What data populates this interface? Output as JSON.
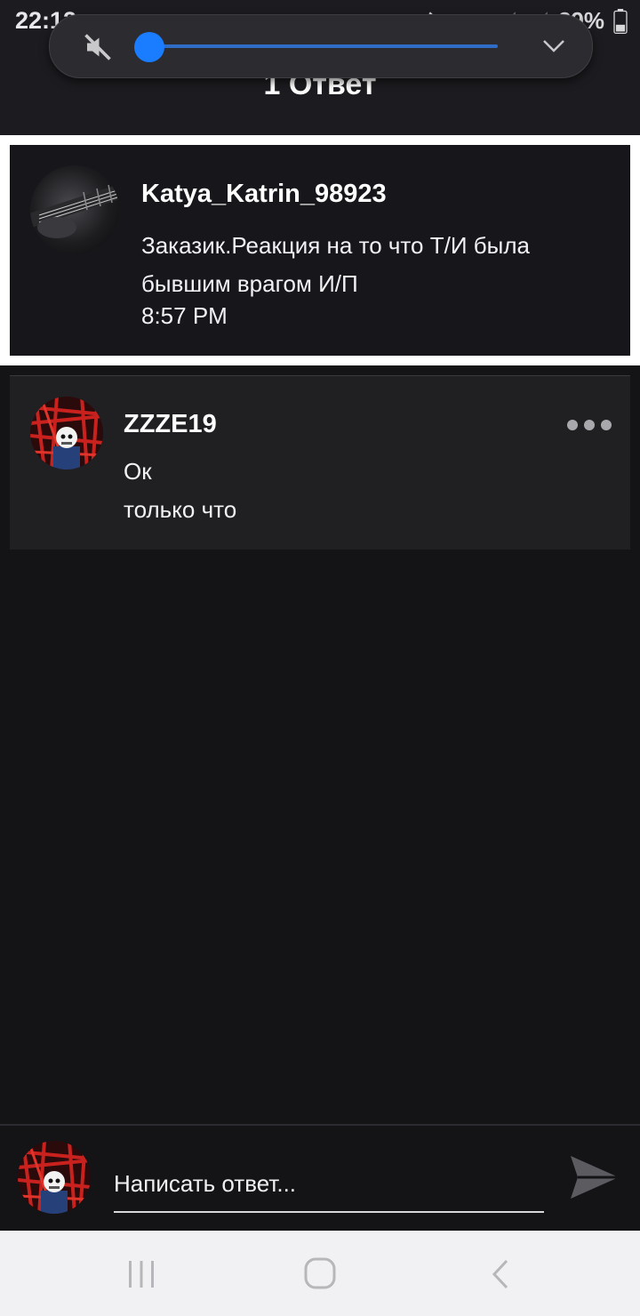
{
  "status_bar": {
    "time": "22:12",
    "battery": "29%",
    "icons": [
      "twitter-icon",
      "mute-icon",
      "wifi-icon",
      "signal-icon",
      "signal-icon",
      "battery-icon"
    ]
  },
  "header": {
    "title": "1 Ответ"
  },
  "volume_panel": {
    "level": 0.0,
    "icons": [
      "mute-icon",
      "chevron-down-icon"
    ],
    "accent": "#1a7cff"
  },
  "post": {
    "author": "Katya_Katrin_98923",
    "text": "Заказик.Реакция на то что Т/И была бывшим врагом И/П",
    "time": "8:57 PM",
    "avatar": "guitar-photo"
  },
  "reply": {
    "author": "ZZZE19",
    "text": "Ок",
    "time": "только что",
    "avatar": "red-skeleton-art",
    "menu_icon": "more-horizontal-icon"
  },
  "composer": {
    "placeholder": "Написать ответ...",
    "value": "",
    "send_icon": "send-icon"
  },
  "nav_bar": {
    "icons": [
      "recents-icon",
      "home-icon",
      "back-icon"
    ]
  },
  "colors": {
    "background": "#141316",
    "card": "#17161a",
    "reply_card": "#202023",
    "frame": "#ffffff",
    "nav_bar": "#f1f1f3"
  }
}
